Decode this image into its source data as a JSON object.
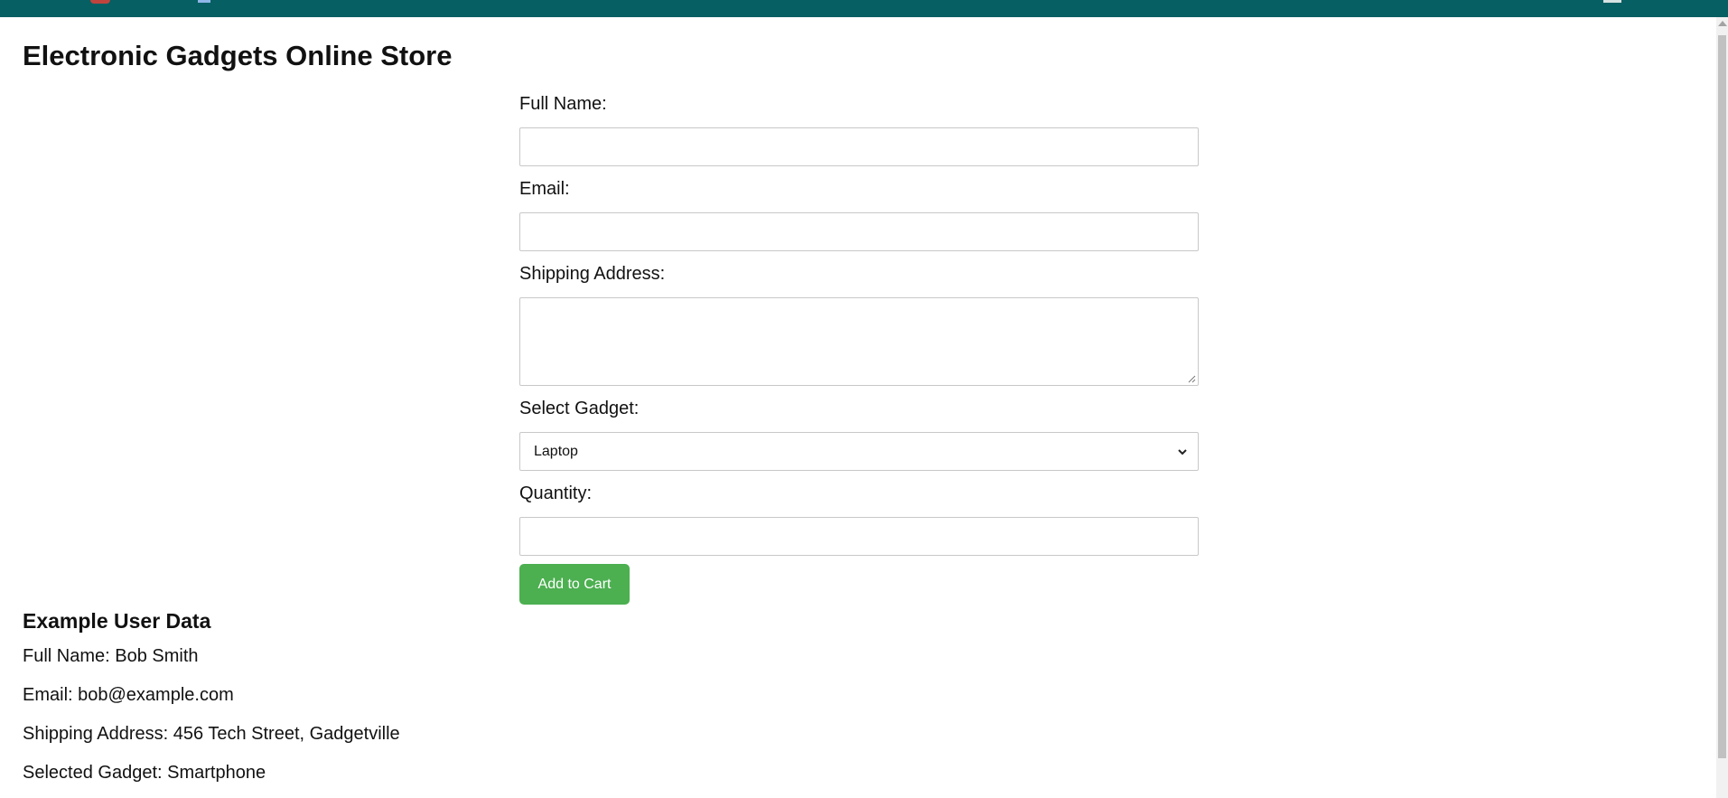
{
  "store": {
    "title": "Electronic Gadgets Online Store"
  },
  "form": {
    "full_name_label": "Full Name:",
    "full_name_value": "",
    "email_label": "Email:",
    "email_value": "",
    "address_label": "Shipping Address:",
    "address_value": "",
    "gadget_label": "Select Gadget:",
    "gadget_selected": "Laptop",
    "quantity_label": "Quantity:",
    "quantity_value": "",
    "add_button_label": "Add to Cart"
  },
  "example": {
    "title": "Example User Data",
    "lines": [
      "Full Name: Bob Smith",
      "Email: bob@example.com",
      "Shipping Address: 456 Tech Street, Gadgetville",
      "Selected Gadget: Smartphone"
    ]
  },
  "colors": {
    "top_bar": "#065f63",
    "button": "#4caf50",
    "button_text": "#ffffff"
  },
  "icons": {
    "select_chevron": "chevron-down-icon",
    "textarea_grip": "resize-grip-icon"
  }
}
